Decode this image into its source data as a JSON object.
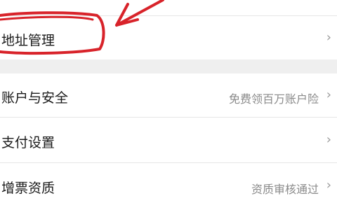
{
  "menu": {
    "items": [
      {
        "label": "地址管理",
        "value": "",
        "chevron": "›"
      },
      {
        "label": "账户与安全",
        "value": "免费领百万账户险",
        "chevron": "›"
      },
      {
        "label": "支付设置",
        "value": "",
        "chevron": "›"
      },
      {
        "label": "增票资质",
        "value": "资质审核通过",
        "chevron": "›"
      }
    ]
  },
  "annotation": {
    "stroke_color": "#d8232a"
  },
  "icons": {
    "chevron": "chevron-right-icon"
  }
}
